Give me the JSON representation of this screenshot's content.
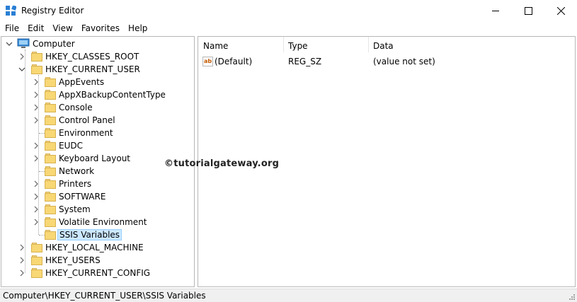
{
  "window": {
    "title": "Registry Editor",
    "controls": {
      "minimize": "minimize-icon",
      "maximize": "maximize-icon",
      "close": "close-icon"
    }
  },
  "menu": [
    "File",
    "Edit",
    "View",
    "Favorites",
    "Help"
  ],
  "tree": {
    "root": "Computer",
    "hives": {
      "classes_root": "HKEY_CLASSES_ROOT",
      "current_user": "HKEY_CURRENT_USER",
      "local_machine": "HKEY_LOCAL_MACHINE",
      "users": "HKEY_USERS",
      "current_config": "HKEY_CURRENT_CONFIG"
    },
    "current_user_children": [
      "AppEvents",
      "AppXBackupContentType",
      "Console",
      "Control Panel",
      "Environment",
      "EUDC",
      "Keyboard Layout",
      "Network",
      "Printers",
      "SOFTWARE",
      "System",
      "Volatile Environment",
      "SSIS Variables"
    ],
    "selected": "SSIS Variables"
  },
  "list": {
    "columns": {
      "name": "Name",
      "type": "Type",
      "data": "Data"
    },
    "rows": [
      {
        "name": "(Default)",
        "type": "REG_SZ",
        "data": "(value not set)",
        "icon": "string-value-icon"
      }
    ]
  },
  "watermark": "©tutorialgateway.org",
  "status": {
    "path": "Computer\\HKEY_CURRENT_USER\\SSIS Variables"
  },
  "colors": {
    "selection": "#cce8ff",
    "folder": "#f8d775",
    "computer_icon": "#3b8ed8"
  }
}
